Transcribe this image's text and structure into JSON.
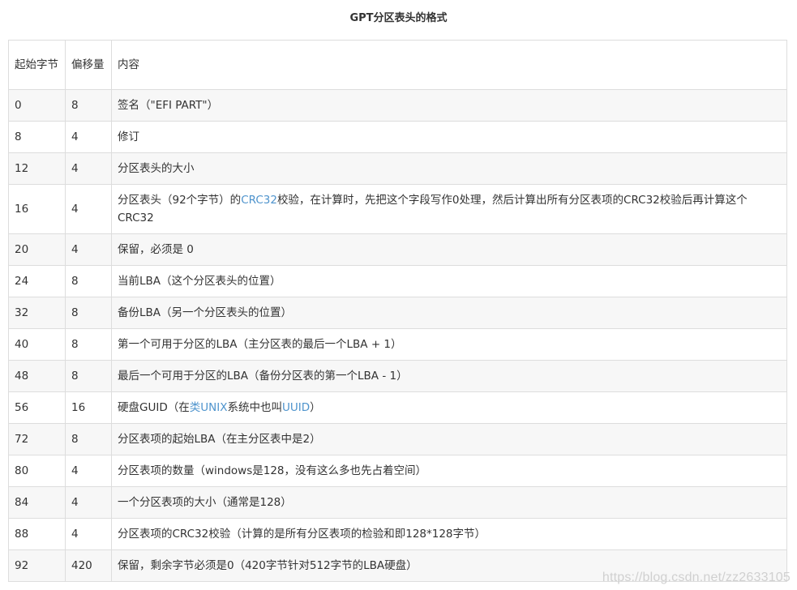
{
  "caption": "GPT分区表头的格式",
  "table": {
    "headers": {
      "start_byte": "起始字节",
      "offset": "偏移量",
      "content": "内容"
    },
    "rows": [
      {
        "start": "0",
        "size": "8",
        "content": "签名（\"EFI PART\"）"
      },
      {
        "start": "8",
        "size": "4",
        "content": "修订"
      },
      {
        "start": "12",
        "size": "4",
        "content": "分区表头的大小"
      },
      {
        "start": "16",
        "size": "4",
        "content_parts": {
          "before": "分区表头（92个字节）的",
          "link": "CRC32",
          "after": "校验，在计算时，先把这个字段写作0处理，然后计算出所有分区表项的CRC32校验后再计算这个CRC32"
        }
      },
      {
        "start": "20",
        "size": "4",
        "content": "保留，必须是 0"
      },
      {
        "start": "24",
        "size": "8",
        "content": "当前LBA（这个分区表头的位置）"
      },
      {
        "start": "32",
        "size": "8",
        "content": "备份LBA（另一个分区表头的位置）"
      },
      {
        "start": "40",
        "size": "8",
        "content": "第一个可用于分区的LBA（主分区表的最后一个LBA + 1）"
      },
      {
        "start": "48",
        "size": "8",
        "content": "最后一个可用于分区的LBA（备份分区表的第一个LBA - 1）"
      },
      {
        "start": "56",
        "size": "16",
        "content_parts": {
          "p1": "硬盘GUID（在",
          "link1": "类UNIX",
          "p2": "系统中也叫",
          "link2": "UUID",
          "p3": "）"
        }
      },
      {
        "start": "72",
        "size": "8",
        "content": "分区表项的起始LBA（在主分区表中是2）"
      },
      {
        "start": "80",
        "size": "4",
        "content": "分区表项的数量（windows是128，没有这么多也先占着空间）"
      },
      {
        "start": "84",
        "size": "4",
        "content": "一个分区表项的大小（通常是128）"
      },
      {
        "start": "88",
        "size": "4",
        "content": "分区表项的CRC32校验（计算的是所有分区表项的检验和即128*128字节）"
      },
      {
        "start": "92",
        "size": "420",
        "content": "保留，剩余字节必须是0（420字节针对512字节的LBA硬盘）"
      }
    ]
  },
  "watermark": "https://blog.csdn.net/zz2633105",
  "colors": {
    "link": "#4f94cd",
    "border": "#dddddd",
    "stripe": "#f7f7f7",
    "text": "#333333"
  }
}
